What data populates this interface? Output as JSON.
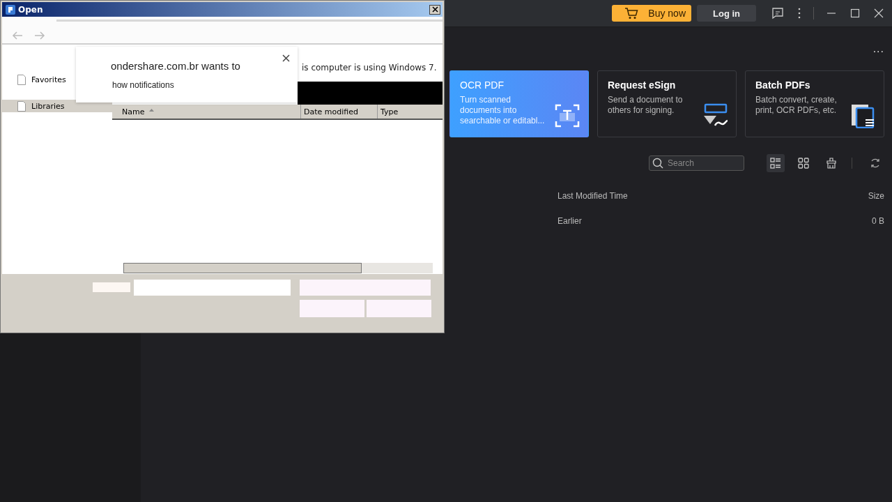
{
  "app": {
    "topbar": {
      "buy_button": "Buy now",
      "login_button": "Log in"
    },
    "more_menu": "...",
    "cards": [
      {
        "title": "OCR PDF",
        "description": "Turn scanned documents into searchable or editabl...",
        "kind": "ocr",
        "selected": true
      },
      {
        "title": "Request eSign",
        "description": "Send a document to others for signing.",
        "kind": "esign",
        "selected": false
      },
      {
        "title": "Batch PDFs",
        "description": "Batch convert, create, print, OCR PDFs, etc.",
        "kind": "batch",
        "selected": false
      }
    ],
    "search": {
      "placeholder": "Search"
    },
    "view_buttons": [
      {
        "kind": "list",
        "selected": true
      },
      {
        "kind": "grid",
        "selected": false
      }
    ],
    "table": {
      "columns": [
        "Last Modified Time",
        "Size"
      ],
      "rows": [
        {
          "group": "Earlier",
          "size": "0 B"
        }
      ]
    }
  },
  "dialog": {
    "title": "Open",
    "notification": {
      "message": "ondershare.com.br wants to",
      "option": "how notifications"
    },
    "page_text": "is computer is using Windows 7.",
    "sidebar": [
      {
        "label": "Favorites",
        "selected": false
      },
      {
        "label": "Libraries",
        "selected": true
      }
    ],
    "columns": [
      {
        "label": "Name",
        "sorted": true
      },
      {
        "label": "Date modified",
        "sorted": false
      },
      {
        "label": "Type",
        "sorted": false
      }
    ]
  }
}
